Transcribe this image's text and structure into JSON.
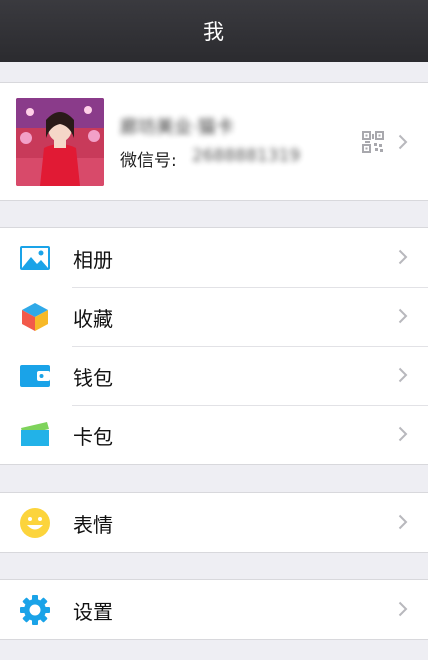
{
  "nav": {
    "title": "我"
  },
  "profile": {
    "name": "廊坊美业·猫卡",
    "wechat_id_label": "微信号:",
    "wechat_id_value": "2688881319",
    "qr_icon": "qr-code-icon"
  },
  "menu": {
    "group1": [
      {
        "label": "相册",
        "icon": "album-icon"
      },
      {
        "label": "收藏",
        "icon": "favorites-icon"
      },
      {
        "label": "钱包",
        "icon": "wallet-icon"
      },
      {
        "label": "卡包",
        "icon": "card-wallet-icon"
      }
    ],
    "group2": [
      {
        "label": "表情",
        "icon": "sticker-smile-icon"
      }
    ],
    "group3": [
      {
        "label": "设置",
        "icon": "settings-gear-icon"
      }
    ]
  },
  "colors": {
    "nav_bg": "#2e2e33",
    "page_bg": "#eeeef3",
    "accent_blue": "#1aa3e8",
    "chevron": "#b8b8bd"
  }
}
